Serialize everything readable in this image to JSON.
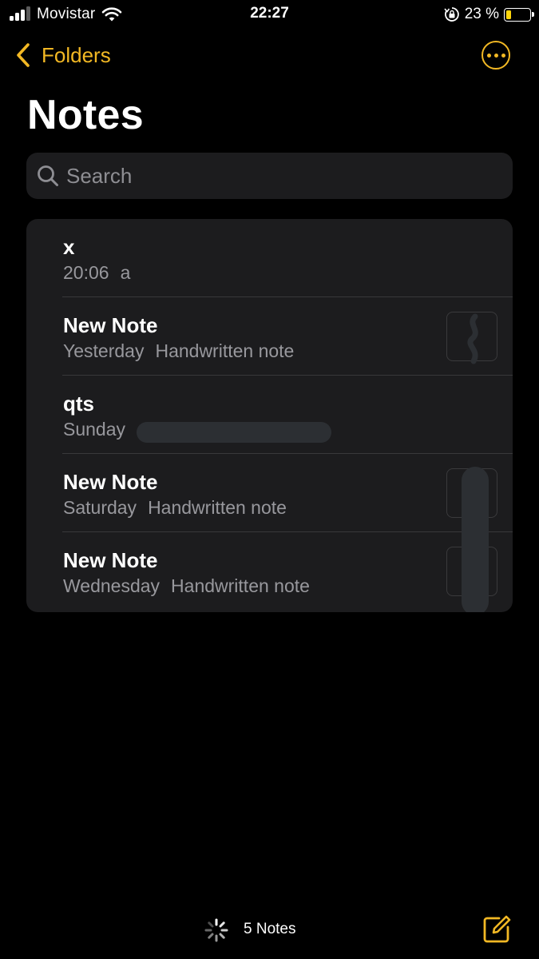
{
  "status_bar": {
    "carrier": "Movistar",
    "time": "22:27",
    "battery_percent": "23 %",
    "battery_level": 0.23,
    "signal_bars_active": 3,
    "signal_bars_total": 4
  },
  "nav": {
    "back_label": "Folders"
  },
  "page": {
    "title": "Notes"
  },
  "search": {
    "placeholder": "Search"
  },
  "notes": [
    {
      "title": "x",
      "date": "20:06",
      "preview": "a",
      "has_thumbnail": false
    },
    {
      "title": "New Note",
      "date": "Yesterday",
      "preview": "Handwritten note",
      "has_thumbnail": true
    },
    {
      "title": "qts",
      "date": "Sunday",
      "preview": "",
      "has_thumbnail": false
    },
    {
      "title": "New Note",
      "date": "Saturday",
      "preview": "Handwritten note",
      "has_thumbnail": true
    },
    {
      "title": "New Note",
      "date": "Wednesday",
      "preview": "Handwritten note",
      "has_thumbnail": true
    }
  ],
  "toolbar": {
    "notes_count": "5 Notes"
  },
  "icons": {
    "wifi": "wifi-icon",
    "rotation_lock": "rotation-lock-icon",
    "back": "chevron-left-icon",
    "more": "ellipsis-circle-icon",
    "search": "search-icon",
    "spinner": "loading-spinner-icon",
    "compose": "compose-icon"
  },
  "colors": {
    "accent": "#f2b824",
    "background": "#000000",
    "card": "#1c1c1e",
    "secondary_text": "#98989d",
    "battery_low": "#ffd60a"
  }
}
